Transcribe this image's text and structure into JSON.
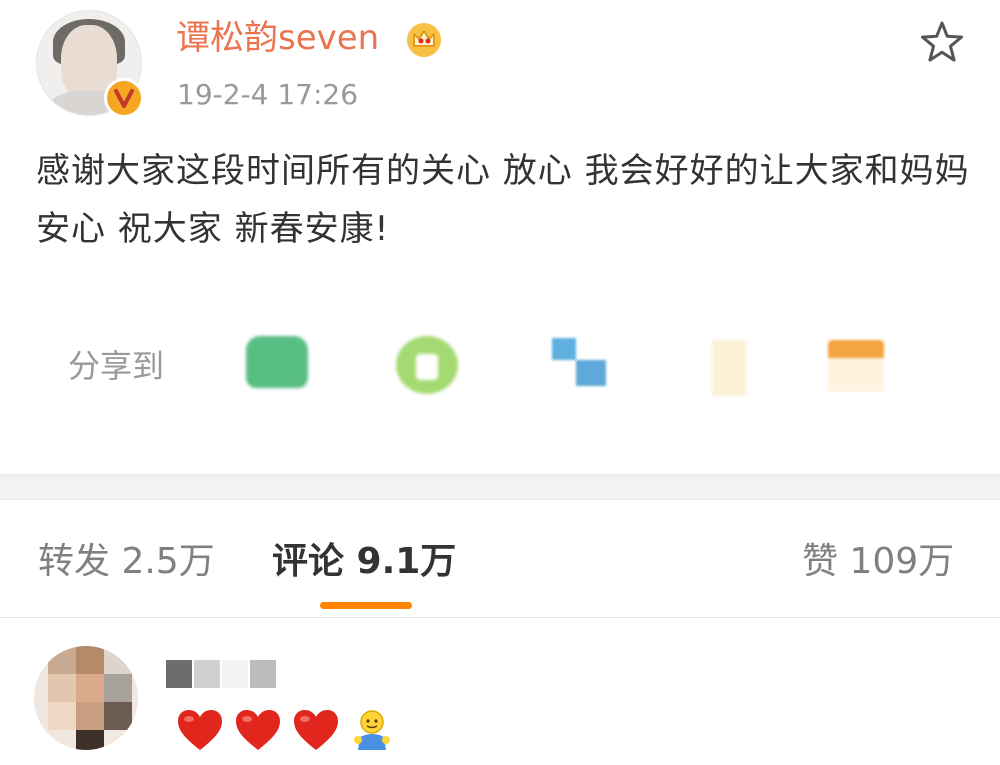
{
  "post": {
    "author": "谭松韵seven",
    "timestamp": "19-2-4 17:26",
    "text": "感谢大家这段时间所有的关心  放心 我会好好的让大家和妈妈安心 祝大家 新春安康!"
  },
  "share": {
    "label": "分享到",
    "targets": [
      "wechat-icon",
      "moments-icon",
      "qq-icon",
      "qzone-icon",
      "more-share-icon"
    ]
  },
  "tabs": {
    "repost": "转发 2.5万",
    "comment": "评论 9.1万",
    "like": "赞 109万",
    "active": "comment"
  },
  "comment": {
    "reactions": [
      "red-heart-icon",
      "red-heart-icon",
      "red-heart-icon",
      "person-icon"
    ]
  },
  "colors": {
    "accent": "#ff8200",
    "username": "#eb7350",
    "muted": "#999999",
    "heart": "#e0261d"
  }
}
